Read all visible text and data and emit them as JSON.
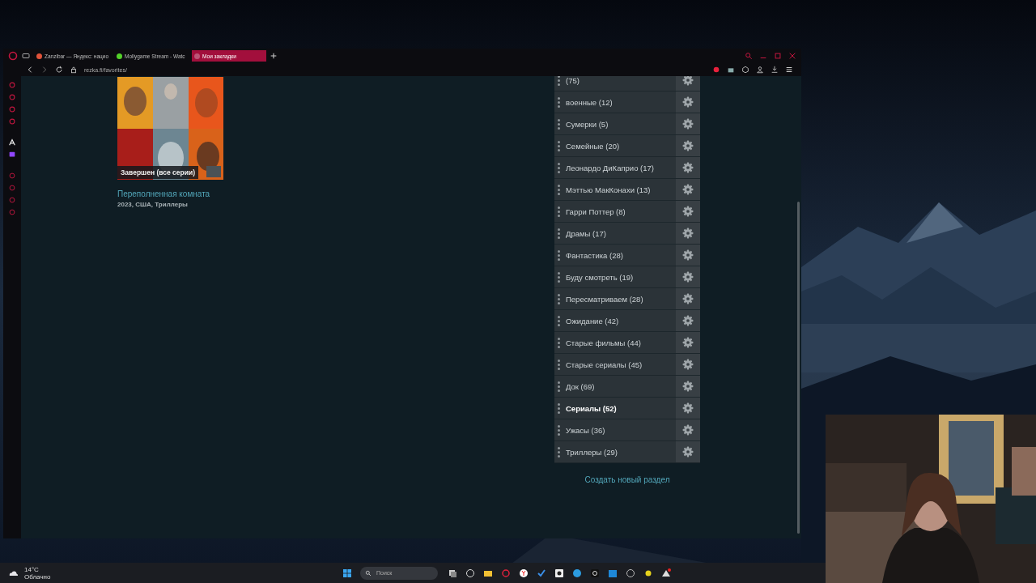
{
  "browser": {
    "tabs": [
      {
        "label": "Zanzibar — Яндекс: нацио",
        "selected": false
      },
      {
        "label": "Mollygame Stream - Watc",
        "selected": false
      },
      {
        "label": "Мои закладки",
        "selected": true
      }
    ],
    "address": "rezka.fi/favorites/"
  },
  "movie": {
    "badge": "Завершен (все серии)",
    "title": "Переполненная комната",
    "meta": "2023, США, Триллеры"
  },
  "categories": [
    {
      "label": "(75)",
      "selected": false
    },
    {
      "label": "военные (12)",
      "selected": false
    },
    {
      "label": "Сумерки (5)",
      "selected": false
    },
    {
      "label": "Семейные (20)",
      "selected": false
    },
    {
      "label": "Леонардо ДиКаприо (17)",
      "selected": false
    },
    {
      "label": "Мэттью МакКонахи (13)",
      "selected": false
    },
    {
      "label": "Гарри Поттер (8)",
      "selected": false
    },
    {
      "label": "Драмы (17)",
      "selected": false
    },
    {
      "label": "Фантастика (28)",
      "selected": false
    },
    {
      "label": "Буду смотреть (19)",
      "selected": false
    },
    {
      "label": "Пересматриваем (28)",
      "selected": false
    },
    {
      "label": "Ожидание (42)",
      "selected": false
    },
    {
      "label": "Старые фильмы (44)",
      "selected": false
    },
    {
      "label": "Старые сериалы (45)",
      "selected": false
    },
    {
      "label": "Док (69)",
      "selected": false
    },
    {
      "label": "Сериалы (52)",
      "selected": true
    },
    {
      "label": "Ужасы (36)",
      "selected": false
    },
    {
      "label": "Триллеры (29)",
      "selected": false
    }
  ],
  "create_link": "Создать новый раздел",
  "taskbar": {
    "weather": {
      "temperature": "14°C",
      "condition": "Облачно"
    },
    "search": {
      "placeholder": "Поиск"
    }
  }
}
